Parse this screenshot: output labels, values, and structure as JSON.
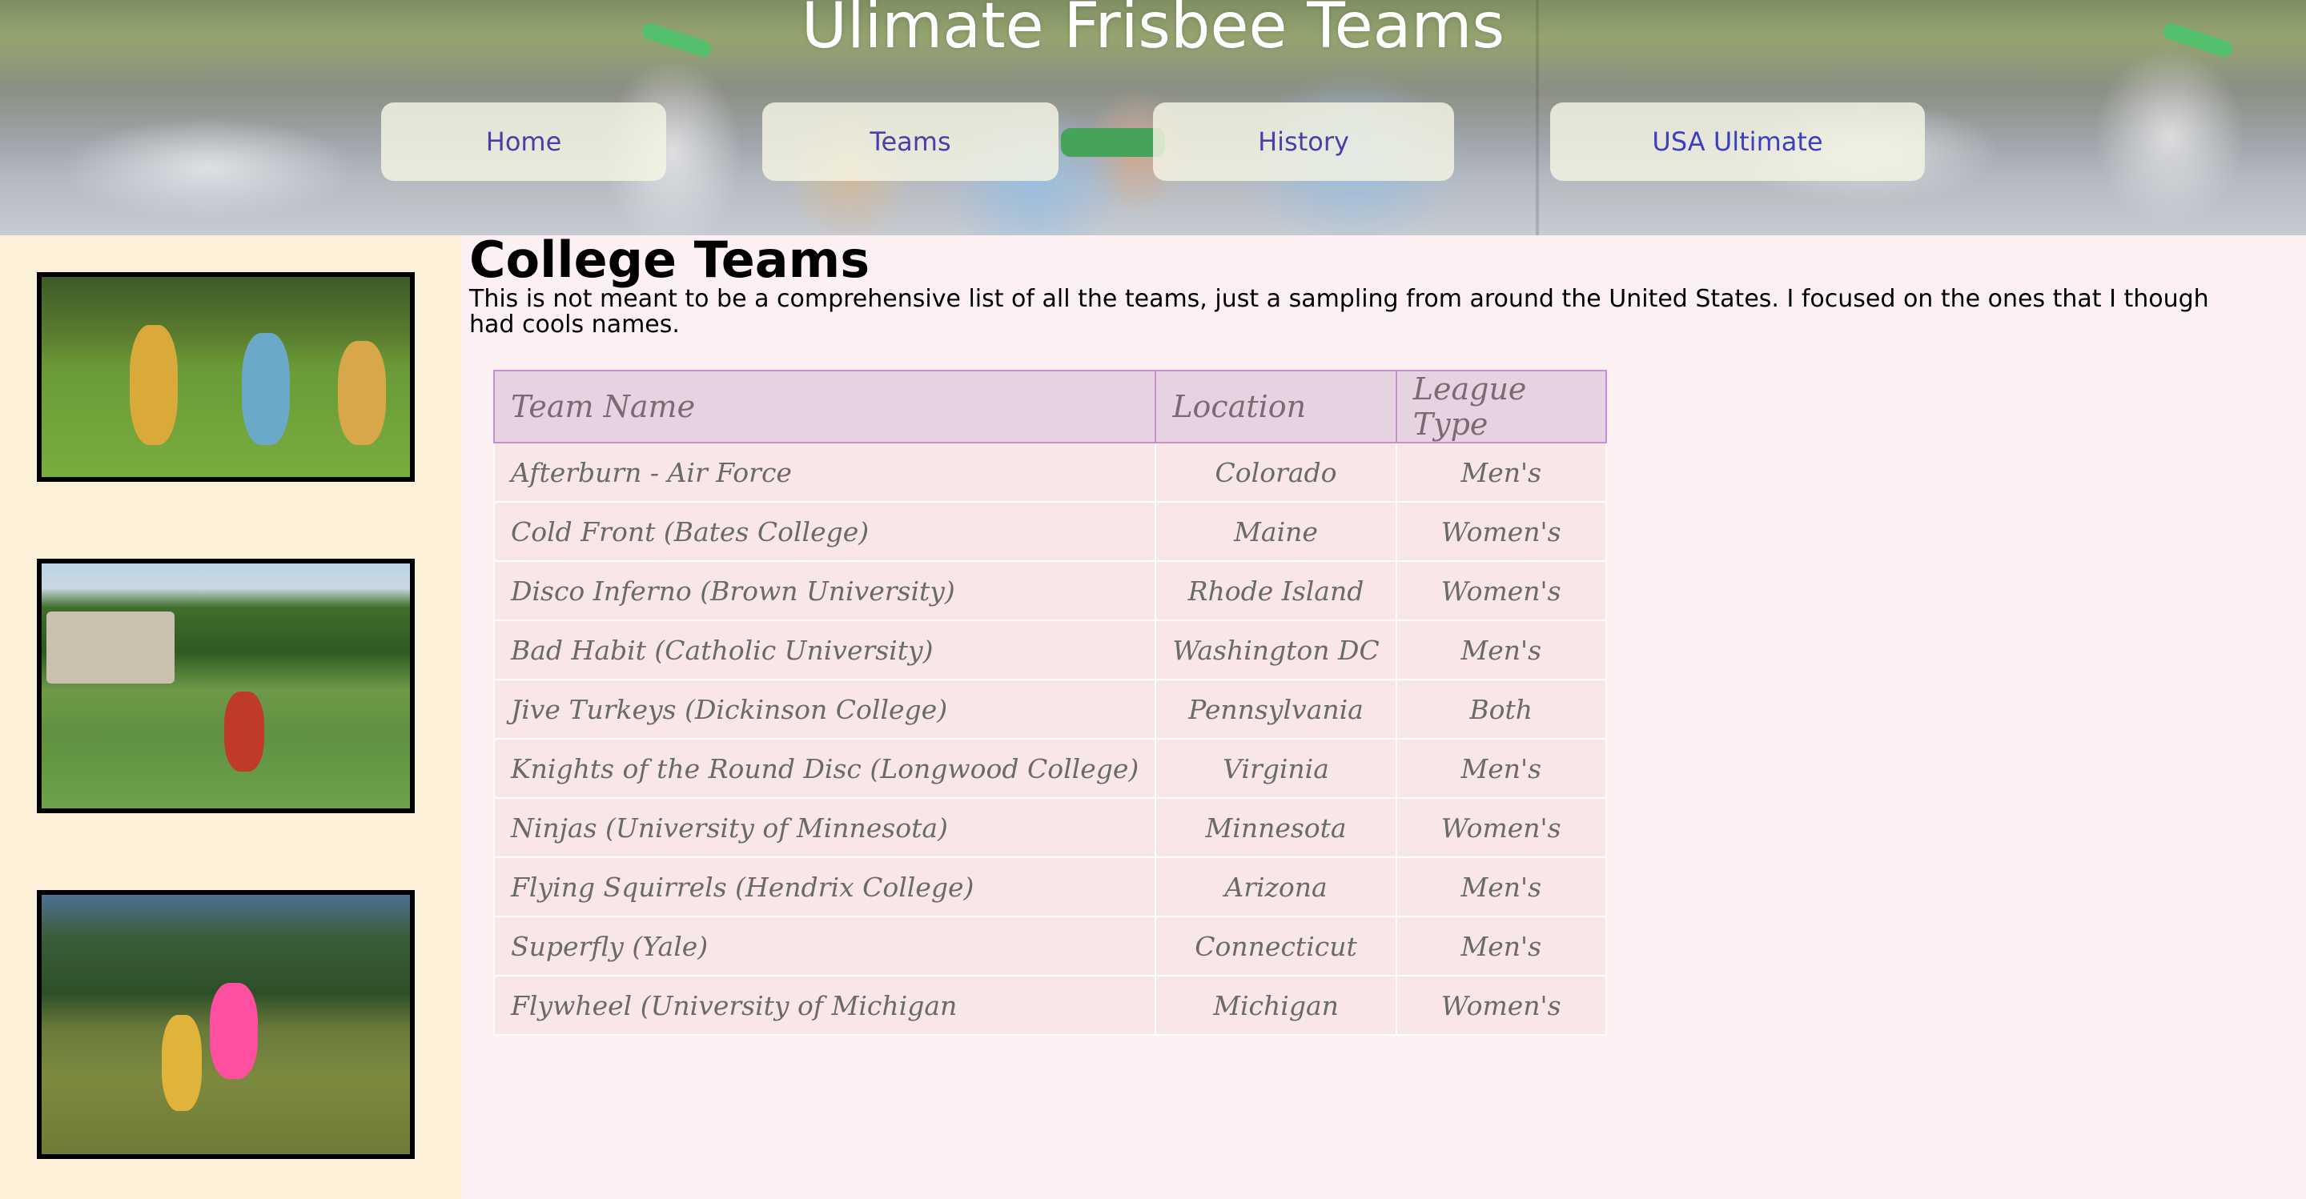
{
  "site": {
    "title": "Ulimate Frisbee Teams"
  },
  "nav": {
    "home": "Home",
    "teams": "Teams",
    "history": "History",
    "usa_ultimate": "USA Ultimate"
  },
  "main": {
    "heading": "College Teams",
    "intro": "This is not meant to be a comprehensive list of all the teams, just a sampling from around the United States. I focused on the ones that I though had cools names.",
    "table": {
      "headers": [
        "Team Name",
        "Location",
        "League Type"
      ],
      "rows": [
        [
          "Afterburn - Air Force",
          "Colorado",
          "Men's"
        ],
        [
          "Cold Front (Bates College)",
          "Maine",
          "Women's"
        ],
        [
          "Disco Inferno (Brown University)",
          "Rhode Island",
          "Women's"
        ],
        [
          "Bad Habit (Catholic University)",
          "Washington DC",
          "Men's"
        ],
        [
          "Jive Turkeys (Dickinson College)",
          "Pennsylvania",
          "Both"
        ],
        [
          "Knights of the Round Disc (Longwood College)",
          "Virginia",
          "Men's"
        ],
        [
          "Ninjas (University of Minnesota)",
          "Minnesota",
          "Women's"
        ],
        [
          "Flying Squirrels (Hendrix College)",
          "Arizona",
          "Men's"
        ],
        [
          "Superfly (Yale)",
          "Connecticut",
          "Men's"
        ],
        [
          "Flywheel (University of Michigan",
          "Michigan",
          "Women's"
        ]
      ]
    }
  },
  "sidebar": {
    "photos": [
      "frisbee-photo-1",
      "frisbee-photo-2",
      "frisbee-photo-3"
    ]
  },
  "colors": {
    "sidebar_bg": "#fcf0d9",
    "page_bg": "#fcf0f3",
    "table_header_bg": "#e6d3e2",
    "table_header_border": "#c98fd0",
    "table_row_bg": "#f9e7e8",
    "nav_text": "#4a3fa8"
  }
}
